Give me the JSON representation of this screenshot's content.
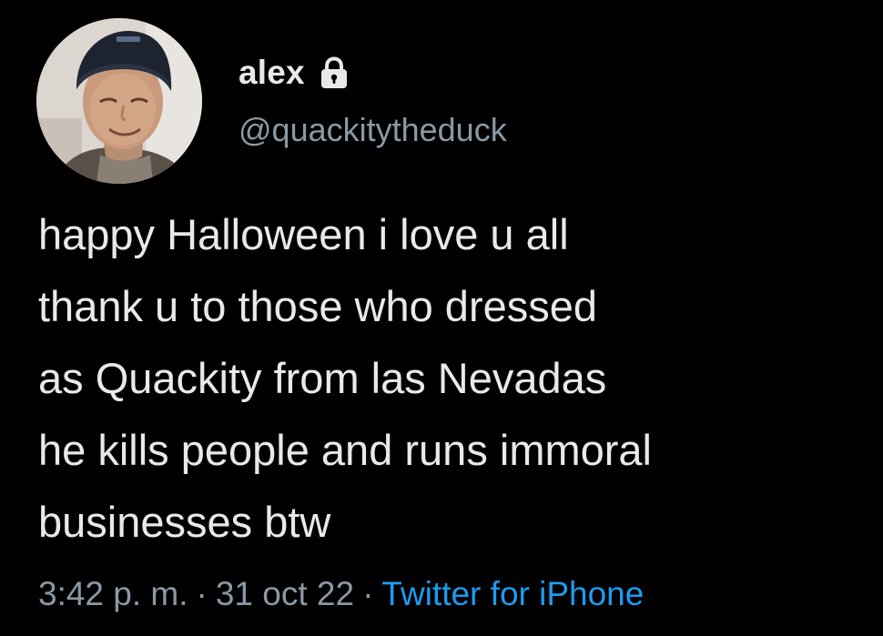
{
  "user": {
    "display_name": "alex",
    "handle": "@quackitytheduck",
    "protected_icon": "lock-icon",
    "avatar_icon": "avatar-photo"
  },
  "tweet": {
    "lines": [
      "happy Halloween i love u all",
      "thank u to those who dressed",
      "as Quackity from las Nevadas",
      "he kills people and runs immoral",
      "businesses btw"
    ]
  },
  "meta": {
    "time": "3:42 p. m.",
    "separator": "·",
    "date": "31 oct 22",
    "source": "Twitter for iPhone"
  },
  "colors": {
    "background": "#000000",
    "primary_text": "#e7e9ea",
    "secondary_text": "#8b98a5",
    "link": "#1d9bf0"
  }
}
